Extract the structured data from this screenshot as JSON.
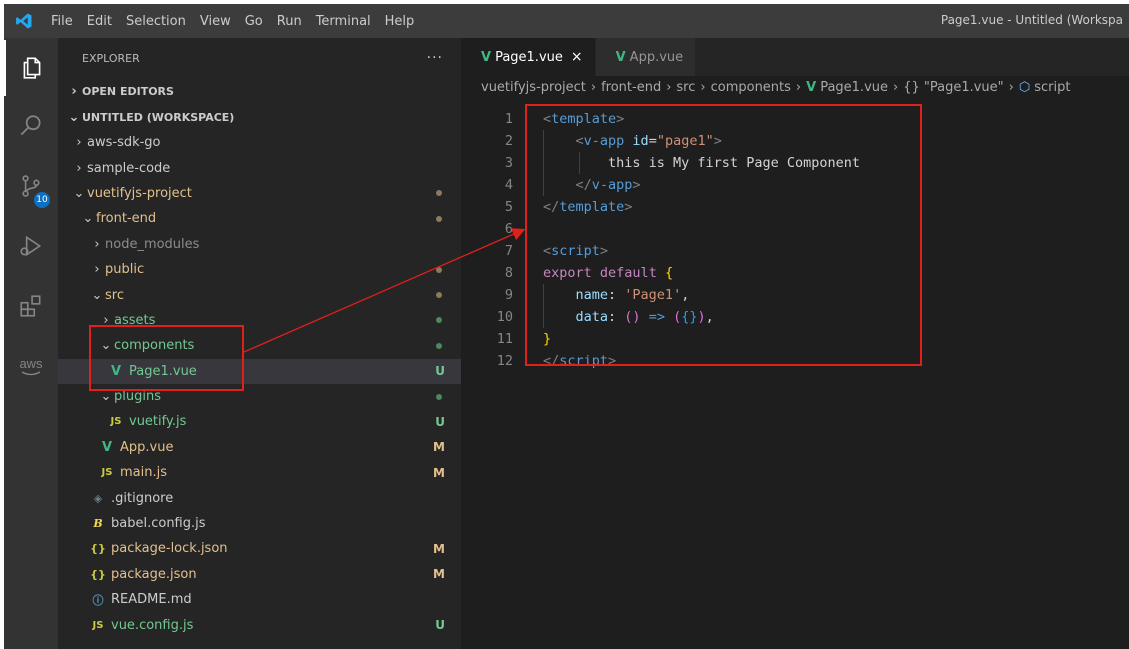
{
  "titlebar": {
    "menu": [
      "File",
      "Edit",
      "Selection",
      "View",
      "Go",
      "Run",
      "Terminal",
      "Help"
    ],
    "window_title": "Page1.vue - Untitled (Workspa"
  },
  "activitybar": {
    "items": [
      "explorer-icon",
      "search-icon",
      "source-control-icon",
      "run-debug-icon",
      "extensions-icon",
      "aws-icon"
    ],
    "source_control_badge": "10",
    "aws_label": "aws"
  },
  "sidebar": {
    "title": "EXPLORER",
    "more_actions": "···",
    "open_editors": "OPEN EDITORS",
    "workspace": "UNTITLED (WORKSPACE)",
    "tree": [
      {
        "label": "aws-sdk-go",
        "chevron": "›",
        "indent": 1,
        "color": "#cccccc"
      },
      {
        "label": "sample-code",
        "chevron": "›",
        "indent": 1,
        "color": "#cccccc"
      },
      {
        "label": "vuetifyjs-project",
        "chevron": "⌄",
        "indent": 1,
        "color": "#e2c08d",
        "dot": "#8c7a5b"
      },
      {
        "label": "front-end",
        "chevron": "⌄",
        "indent": 2,
        "color": "#e2c08d",
        "dot": "#8c7a5b"
      },
      {
        "label": "node_modules",
        "chevron": "›",
        "indent": 3,
        "color": "#8c8c8c"
      },
      {
        "label": "public",
        "chevron": "›",
        "indent": 3,
        "color": "#e2c08d",
        "dot": "#8c7a5b"
      },
      {
        "label": "src",
        "chevron": "⌄",
        "indent": 3,
        "color": "#e2c08d",
        "dot": "#8c7a5b"
      },
      {
        "label": "assets",
        "chevron": "›",
        "indent": 4,
        "color": "#73c991",
        "dot": "#4b8a5e"
      },
      {
        "label": "components",
        "chevron": "⌄",
        "indent": 4,
        "color": "#73c991",
        "dot": "#4b8a5e"
      },
      {
        "label": "Page1.vue",
        "icon": "vue",
        "indent": 5,
        "color": "#73c991",
        "status": "U",
        "selected": true
      },
      {
        "label": "plugins",
        "chevron": "⌄",
        "indent": 4,
        "color": "#73c991",
        "dot": "#4b8a5e"
      },
      {
        "label": "vuetify.js",
        "icon": "js",
        "indent": 5,
        "color": "#73c991",
        "status": "U"
      },
      {
        "label": "App.vue",
        "icon": "vue",
        "indent": 4,
        "color": "#e2c08d",
        "status": "M"
      },
      {
        "label": "main.js",
        "icon": "js",
        "indent": 4,
        "color": "#e2c08d",
        "status": "M"
      },
      {
        "label": ".gitignore",
        "icon": "git",
        "indent": 3,
        "color": "#cccccc"
      },
      {
        "label": "babel.config.js",
        "icon": "babel",
        "indent": 3,
        "color": "#cccccc"
      },
      {
        "label": "package-lock.json",
        "icon": "json",
        "indent": 3,
        "color": "#e2c08d",
        "status": "M"
      },
      {
        "label": "package.json",
        "icon": "json",
        "indent": 3,
        "color": "#e2c08d",
        "status": "M"
      },
      {
        "label": "README.md",
        "icon": "info",
        "indent": 3,
        "color": "#cccccc"
      },
      {
        "label": "vue.config.js",
        "icon": "js",
        "indent": 3,
        "color": "#73c991",
        "status": "U"
      }
    ]
  },
  "icon_glyphs": {
    "vue": "V",
    "js": "JS",
    "json": "{}",
    "git": "◈",
    "info": "ⓘ",
    "babel": "B"
  },
  "editor": {
    "tabs": [
      {
        "label": "Page1.vue",
        "active": true,
        "close": "×"
      },
      {
        "label": "App.vue",
        "active": false
      }
    ],
    "breadcrumb": [
      "vuetifyjs-project",
      "front-end",
      "src",
      "components",
      "Page1.vue",
      "{} \"Page1.vue\"",
      "script"
    ],
    "lines": [
      [
        [
          "t-br",
          "<"
        ],
        [
          "t-tag",
          "template"
        ],
        [
          "t-br",
          ">"
        ]
      ],
      [
        [
          "",
          "    "
        ],
        [
          "t-br",
          "<"
        ],
        [
          "t-tag",
          "v-app"
        ],
        [
          "",
          ""
        ],
        [
          "t-attr",
          " id"
        ],
        [
          "",
          "="
        ],
        [
          "t-str",
          "\"page1\""
        ],
        [
          "t-br",
          ">"
        ]
      ],
      [
        [
          "",
          "        this is My first Page Component"
        ]
      ],
      [
        [
          "",
          "    "
        ],
        [
          "t-br",
          "</"
        ],
        [
          "t-tag",
          "v-app"
        ],
        [
          "t-br",
          ">"
        ]
      ],
      [
        [
          "t-br",
          "</"
        ],
        [
          "t-tag",
          "template"
        ],
        [
          "t-br",
          ">"
        ]
      ],
      [],
      [
        [
          "t-br",
          "<"
        ],
        [
          "t-tag",
          "script"
        ],
        [
          "t-br",
          ">"
        ]
      ],
      [
        [
          "t-kw",
          "export"
        ],
        [
          "",
          " "
        ],
        [
          "t-kw",
          "default"
        ],
        [
          "",
          " "
        ],
        [
          "t-brk",
          "{"
        ]
      ],
      [
        [
          "",
          "    "
        ],
        [
          "t-prop",
          "name"
        ],
        [
          "",
          ": "
        ],
        [
          "t-str",
          "'Page1'"
        ],
        [
          "",
          ","
        ]
      ],
      [
        [
          "",
          "    "
        ],
        [
          "t-prop",
          "data"
        ],
        [
          "",
          ": "
        ],
        [
          "t-brk2",
          "()"
        ],
        [
          "",
          " "
        ],
        [
          "t-kw2",
          "=>"
        ],
        [
          "",
          " "
        ],
        [
          "t-brk2",
          "("
        ],
        [
          "t-brk3",
          "{}"
        ],
        [
          "t-brk2",
          ")"
        ],
        [
          "",
          ","
        ]
      ],
      [
        [
          "t-brk",
          "}"
        ]
      ],
      [
        [
          "t-br",
          "</"
        ],
        [
          "t-tag",
          "script"
        ],
        [
          "t-br",
          ">"
        ]
      ]
    ]
  },
  "colors": {
    "accent_red": "#e0201b",
    "vue_green": "#41b883",
    "badge_blue": "#0e70c0"
  }
}
